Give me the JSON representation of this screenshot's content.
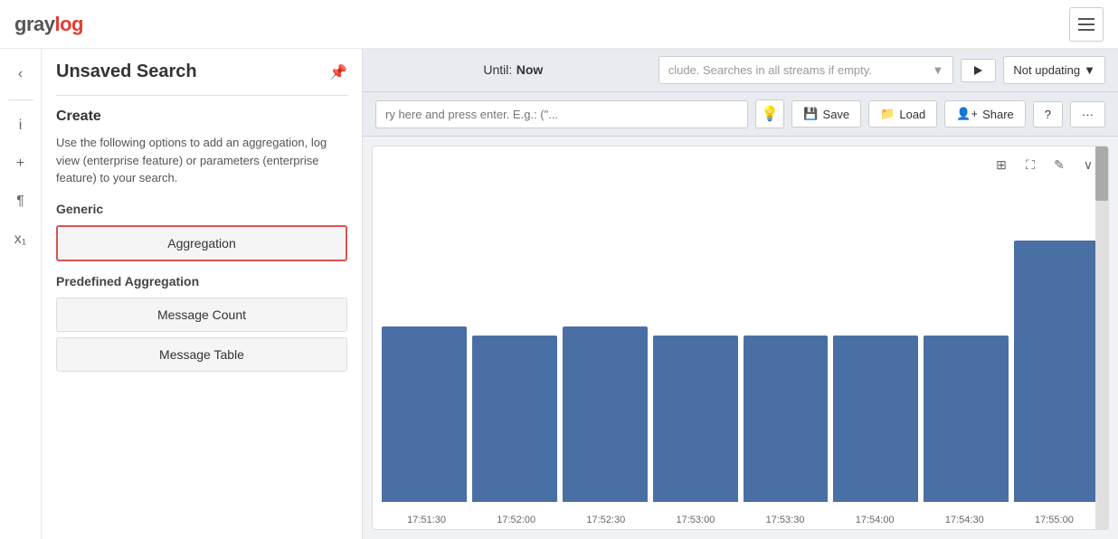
{
  "brand": {
    "gray": "gray",
    "log": "log"
  },
  "navbar": {
    "hamburger_label": "Menu"
  },
  "iconbar": {
    "back": "‹",
    "info": "i",
    "add": "+",
    "paragraph": "¶",
    "subscript": "x₁"
  },
  "sidebar": {
    "title": "Unsaved Search",
    "pin_icon": "📌",
    "create_heading": "Create",
    "create_description": "Use the following options to add an aggregation, log view (enterprise feature) or parameters (enterprise feature) to your search.",
    "generic_label": "Generic",
    "aggregation_btn": "Aggregation",
    "predefined_label": "Predefined Aggregation",
    "message_count_btn": "Message Count",
    "message_table_btn": "Message Table"
  },
  "search_header": {
    "until_label": "Until:",
    "until_value": "Now",
    "streams_placeholder": "clude. Searches in all streams if empty.",
    "run_label": "Not updating",
    "query_placeholder": "ry here and press enter. E.g.: (\"..."
  },
  "toolbar": {
    "save_label": "Save",
    "load_label": "Load",
    "share_label": "Share",
    "help_label": "?",
    "more_label": "···"
  },
  "chart": {
    "bars": [
      {
        "height_pct": 55
      },
      {
        "height_pct": 52
      },
      {
        "height_pct": 55
      },
      {
        "height_pct": 52
      },
      {
        "height_pct": 52
      },
      {
        "height_pct": 52
      },
      {
        "height_pct": 52
      },
      {
        "height_pct": 82
      }
    ],
    "x_labels": [
      "17:51:30",
      "17:52:00",
      "17:52:30",
      "17:53:00",
      "17:53:30",
      "17:54:00",
      "17:54:30",
      "17:55:00"
    ],
    "toolbar_icons": [
      "⊞",
      "⛶",
      "✎",
      "∨"
    ]
  }
}
